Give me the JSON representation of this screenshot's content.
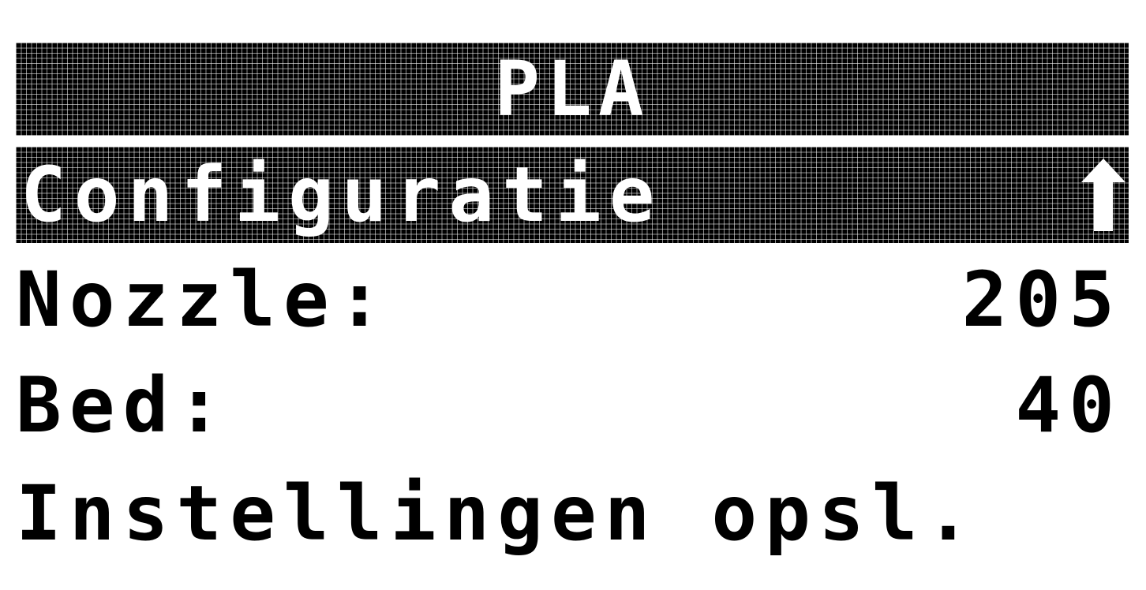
{
  "header": {
    "title": "PLA"
  },
  "menu": {
    "items": [
      {
        "label": "Configuratie",
        "icon": "up-arrow-icon",
        "selected": true
      },
      {
        "label": "Nozzle:",
        "value": "205"
      },
      {
        "label": "Bed:",
        "value": "40"
      },
      {
        "label": "Instellingen opsl."
      }
    ]
  },
  "colors": {
    "foreground": "#000000",
    "background": "#ffffff"
  }
}
